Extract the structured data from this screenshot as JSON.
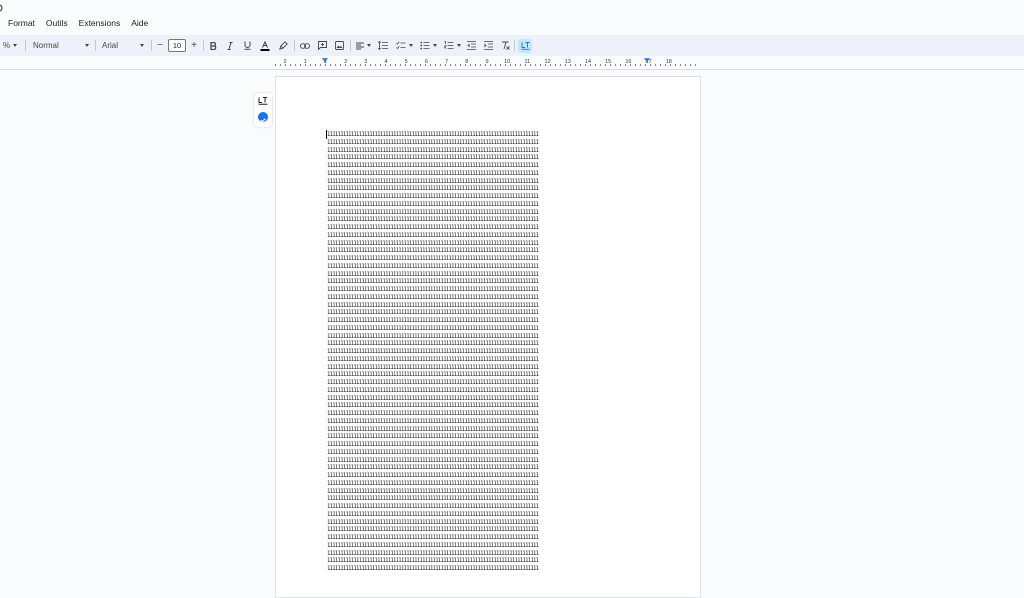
{
  "menu": {
    "items": [
      "Format",
      "Outils",
      "Extensions",
      "Aide"
    ]
  },
  "toolbar": {
    "zoom_fragment": "%",
    "style_select": "Normal",
    "font_select": "Arial",
    "font_size": "10",
    "decrease_label": "−",
    "increase_label": "+"
  },
  "ruler": {
    "numbers": [
      "2",
      "1",
      "1",
      "2",
      "3",
      "4",
      "5",
      "6",
      "7",
      "8",
      "9",
      "10",
      "11",
      "12",
      "13",
      "14",
      "15",
      "16",
      "17",
      "18"
    ]
  },
  "document": {
    "line_text": "11111111111111111111111111111111111111111111111111111111111111111111111111111111",
    "visible_lines": 57
  },
  "colors": {
    "toolbar_bg": "#edf2fa",
    "accent_blue": "#1a73e8",
    "active_button": "#c2e7ff",
    "indent_marker": "#4c8bf5"
  },
  "icons": [
    "undo-icon",
    "chevron-down-icon",
    "bold-icon",
    "italic-icon",
    "underline-icon",
    "text-color-icon",
    "highlight-icon",
    "link-icon",
    "comment-icon",
    "image-icon",
    "align-icon",
    "line-spacing-icon",
    "checklist-icon",
    "bullet-list-icon",
    "numbered-list-icon",
    "decrease-indent-icon",
    "increase-indent-icon",
    "clear-formatting-icon",
    "languagetool-icon",
    "check-circle-icon"
  ]
}
